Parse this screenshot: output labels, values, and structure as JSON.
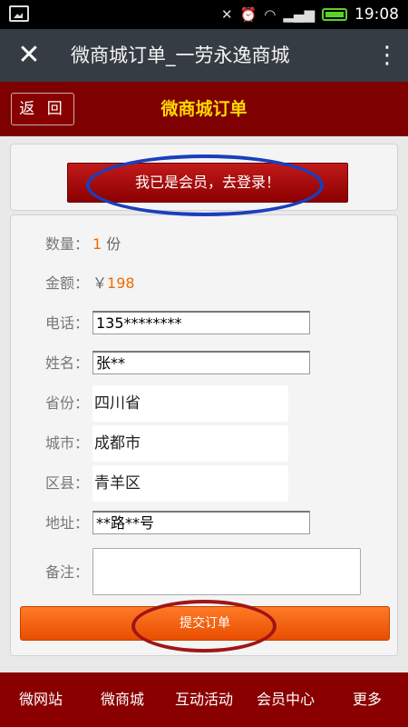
{
  "status_bar": {
    "time": "19:08"
  },
  "app_bar": {
    "title": "微商城订单_一劳永逸商城",
    "close_icon": "close-icon",
    "menu_icon": "more-vertical-icon"
  },
  "page_header": {
    "back_label": "返 回",
    "title": "微商城订单"
  },
  "login": {
    "label": "我已是会员，去登录！"
  },
  "order": {
    "quantity": {
      "label": "数量：",
      "value": "1",
      "unit": " 份"
    },
    "amount": {
      "label": "金额：",
      "currency": "￥",
      "value": "198"
    },
    "phone": {
      "label": "电话：",
      "value": "135********"
    },
    "name": {
      "label": "姓名：",
      "value": "张**"
    },
    "province": {
      "label": "省份：",
      "value": "四川省"
    },
    "city": {
      "label": "城市：",
      "value": "成都市"
    },
    "district": {
      "label": "区县：",
      "value": "青羊区"
    },
    "address": {
      "label": "地址：",
      "value": "**路**号"
    },
    "note": {
      "label": "备注：",
      "value": ""
    }
  },
  "submit": {
    "label": "提交订单"
  },
  "bottom_nav": {
    "items": [
      "微网站",
      "微商城",
      "互动活动",
      "会员中心",
      "更多"
    ]
  },
  "colors": {
    "header_red": "#7e0000",
    "title_yellow": "#ffd800",
    "submit_orange": "#f06010",
    "accent_orange": "#ef6a00",
    "annotation_blue": "#1a3fbd",
    "annotation_red": "#a01515"
  }
}
